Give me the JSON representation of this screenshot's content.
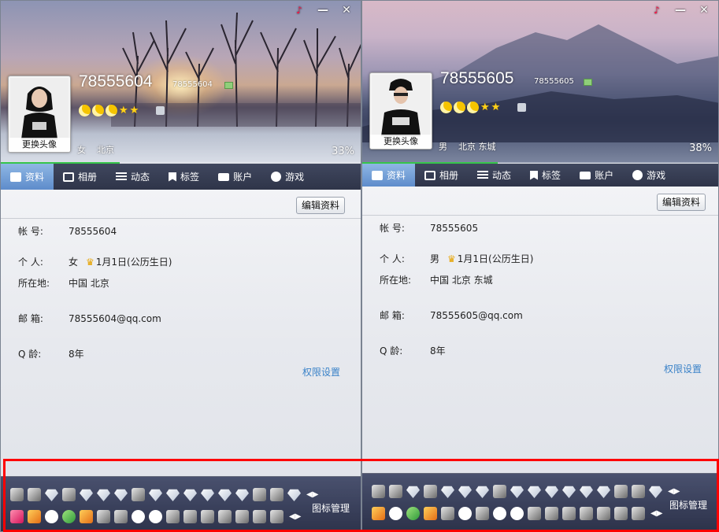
{
  "window_controls": {
    "skin": "♪",
    "minimize": "—",
    "close": "✕"
  },
  "profiles": [
    {
      "qq_number": "78555604",
      "nickname": "78555604",
      "avatar_label": "更换头像",
      "gender": "女",
      "location": "北京",
      "completeness": "33%",
      "completeness_value": 0.33,
      "tabs": [
        "资料",
        "相册",
        "动态",
        "标签",
        "账户",
        "游戏"
      ],
      "edit_button": "编辑资料",
      "fields": {
        "account_label": "帐    号:",
        "account_value": "78555604",
        "personal_label": "个    人:",
        "personal_gender": "女",
        "birthday": "1月1日(公历生日)",
        "location_label": "所在地:",
        "location_value": "中国 北京",
        "email_label": "邮    箱:",
        "email_value": "78555604@qq.com",
        "qage_label": "Q    龄:",
        "qage_value": "8年"
      },
      "permissions_link": "权限设置",
      "icon_manage": "图标管理"
    },
    {
      "qq_number": "78555605",
      "nickname": "78555605",
      "avatar_label": "更换头像",
      "gender": "男",
      "location": "北京 东城",
      "completeness": "38%",
      "completeness_value": 0.38,
      "tabs": [
        "资料",
        "相册",
        "动态",
        "标签",
        "账户",
        "游戏"
      ],
      "edit_button": "编辑资料",
      "fields": {
        "account_label": "帐    号:",
        "account_value": "78555605",
        "personal_label": "个    人:",
        "personal_gender": "男",
        "birthday": "1月1日(公历生日)",
        "location_label": "所在地:",
        "location_value": "中国 北京 东城",
        "email_label": "邮    箱:",
        "email_value": "78555605@qq.com",
        "qage_label": "Q    龄:",
        "qage_value": "8年"
      },
      "permissions_link": "权限设置",
      "icon_manage": "图标管理"
    }
  ],
  "colors": {
    "accent_tab": "#5e8ccb",
    "link": "#3a82c8",
    "highlight_frame": "#ff0000",
    "progress": "#36c54a"
  }
}
